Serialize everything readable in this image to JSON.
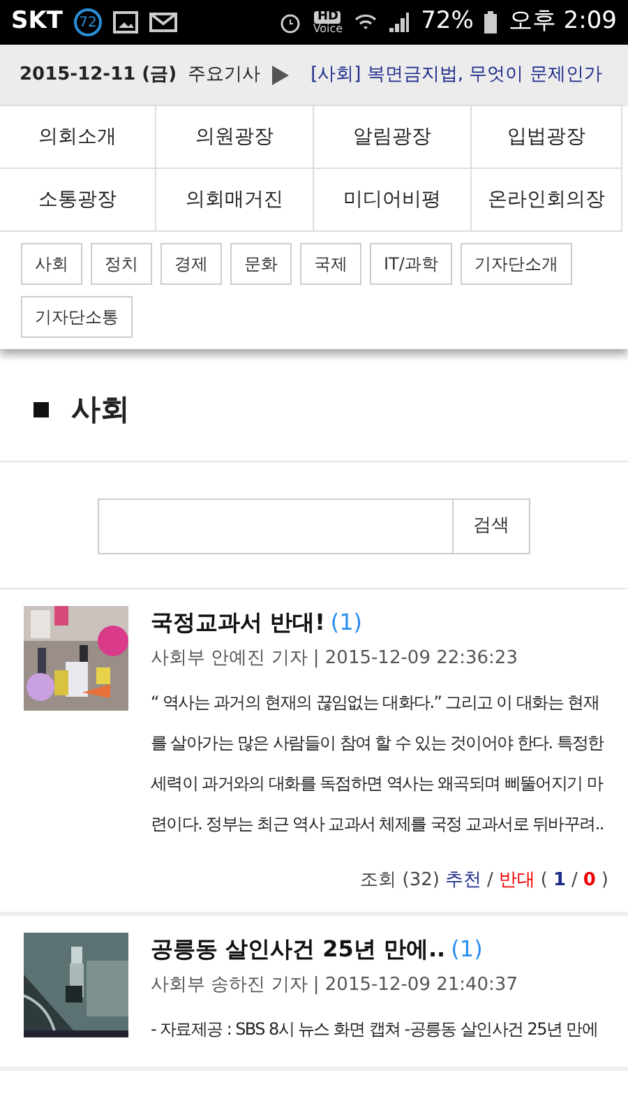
{
  "status_bar": {
    "carrier": "SKT",
    "notification_count": "72",
    "hd_label": "HD",
    "voice_label": "Voice",
    "battery_percent": "72%",
    "time": "오후 2:09"
  },
  "ticker": {
    "date": "2015-12-11 (금)",
    "label": "주요기사",
    "headline": "[사회] 복면금지법, 무엇이 문제인가"
  },
  "main_menu": [
    {
      "label": "의회소개"
    },
    {
      "label": "의원광장"
    },
    {
      "label": "알림광장"
    },
    {
      "label": "입법광장"
    },
    {
      "label": "소통광장"
    },
    {
      "label": "의회매거진"
    },
    {
      "label": "미디어비평"
    },
    {
      "label": "온라인회의장"
    }
  ],
  "sub_menu": [
    {
      "label": "사회"
    },
    {
      "label": "정치"
    },
    {
      "label": "경제"
    },
    {
      "label": "문화"
    },
    {
      "label": "국제"
    },
    {
      "label": "IT/과학"
    },
    {
      "label": "기자단소개"
    },
    {
      "label": "기자단소통"
    }
  ],
  "section_title": "사회",
  "search": {
    "button": "검색"
  },
  "articles": [
    {
      "title": "국정교과서 반대!",
      "comments": "(1)",
      "byline": "사회부 안예진 기자 | 2015-12-09 22:36:23",
      "summary": "“ 역사는 과거의 현재의 끊임없는 대화다.” 그리고 이 대화는 현재를 살아가는 많은 사람들이 참여 할 수 있는 것이어야 한다. 특정한 세력이 과거와의 대화를 독점하면 역사는 왜곡되며 삐뚤어지기 마련이다. 정부는 최근 역사 교과서 체제를 국정 교과서로 뒤바꾸려..",
      "stats": [
        {
          "text": "조회 (32)",
          "color": "#444444",
          "bold": false
        },
        {
          "text": "추천",
          "color": "#1b2a8a",
          "bold": false
        },
        {
          "text": "/",
          "color": "#444444",
          "bold": false
        },
        {
          "text": "반대",
          "color": "#ee0000",
          "bold": false
        },
        {
          "text": "(",
          "color": "#444444",
          "bold": false
        },
        {
          "text": "1",
          "color": "#1b2a8a",
          "bold": true
        },
        {
          "text": "/",
          "color": "#444444",
          "bold": false
        },
        {
          "text": "0",
          "color": "#ee0000",
          "bold": true
        },
        {
          "text": ")",
          "color": "#444444",
          "bold": false
        }
      ]
    },
    {
      "title": "공릉동 살인사건 25년 만에..",
      "comments": "(1)",
      "byline": "사회부 송하진 기자 | 2015-12-09 21:40:37",
      "summary": "- 자료제공 : SBS 8시 뉴스 화면 캡쳐 -공릉동 살인사건 25년 만에"
    }
  ]
}
